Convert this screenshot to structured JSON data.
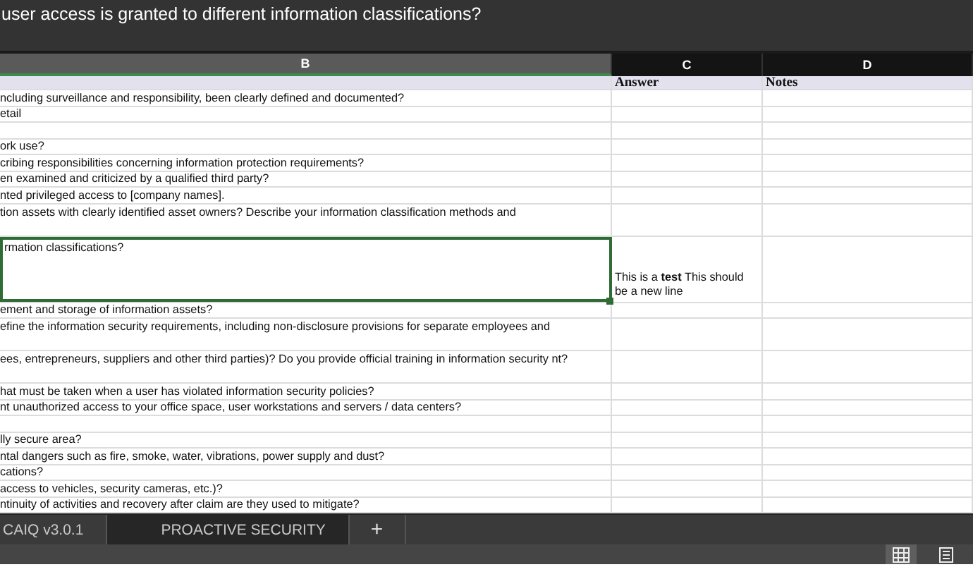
{
  "formula_bar": {
    "text": "user access is granted to different information classifications?"
  },
  "column_headers": [
    {
      "label": "B",
      "selected": true
    },
    {
      "label": "C",
      "selected": false
    },
    {
      "label": "D",
      "selected": false
    }
  ],
  "rows": [
    {
      "kind": "header",
      "selected": false,
      "cells": [
        "",
        "Answer",
        "Notes"
      ]
    },
    {
      "kind": "normal",
      "selected": false,
      "cells": [
        "ncluding surveillance and responsibility, been clearly defined and documented?",
        "",
        ""
      ]
    },
    {
      "kind": "normal",
      "selected": false,
      "cells": [
        "etail",
        "",
        ""
      ]
    },
    {
      "kind": "normal",
      "selected": false,
      "cells": [
        "",
        "",
        ""
      ]
    },
    {
      "kind": "normal",
      "selected": false,
      "cells": [
        "ork use?",
        "",
        ""
      ]
    },
    {
      "kind": "normal",
      "selected": false,
      "cells": [
        "cribing responsibilities concerning information protection requirements?",
        "",
        ""
      ]
    },
    {
      "kind": "normal",
      "selected": false,
      "cells": [
        "en examined and criticized by a qualified third party?",
        "",
        ""
      ]
    },
    {
      "kind": "normal",
      "selected": false,
      "cells": [
        "nted privileged access to [company names].",
        "",
        ""
      ]
    },
    {
      "kind": "double",
      "selected": false,
      "cells": [
        "tion assets with clearly identified asset owners? Describe your information classification methods and",
        "",
        ""
      ]
    },
    {
      "kind": "tall",
      "selected": true,
      "cells": [
        "rmation classifications?",
        "This is a **test** This   should be a new line",
        ""
      ]
    },
    {
      "kind": "normal",
      "selected": false,
      "cells": [
        "ement and storage of information assets?",
        "",
        ""
      ]
    },
    {
      "kind": "double",
      "selected": false,
      "cells": [
        "efine the information security requirements, including non-disclosure provisions for separate employees and",
        "",
        ""
      ]
    },
    {
      "kind": "double",
      "selected": false,
      "cells": [
        "ees, entrepreneurs, suppliers and other third parties)? Do you provide official training in information security nt?",
        "",
        ""
      ]
    },
    {
      "kind": "normal",
      "selected": false,
      "cells": [
        "hat must be taken when a user has violated information security policies?",
        "",
        ""
      ]
    },
    {
      "kind": "normal",
      "selected": false,
      "cells": [
        "nt unauthorized access to your office space, user workstations and servers / data centers?",
        "",
        ""
      ]
    },
    {
      "kind": "normal",
      "selected": false,
      "cells": [
        "",
        "",
        ""
      ]
    },
    {
      "kind": "normal",
      "selected": false,
      "cells": [
        "lly secure area?",
        "",
        ""
      ]
    },
    {
      "kind": "normal",
      "selected": false,
      "cells": [
        "ntal dangers such as fire, smoke, water, vibrations, power supply and dust?",
        "",
        ""
      ]
    },
    {
      "kind": "normal",
      "selected": false,
      "cells": [
        "cations?",
        "",
        ""
      ]
    },
    {
      "kind": "normal",
      "selected": false,
      "cells": [
        "access to vehicles, security cameras, etc.)?",
        "",
        ""
      ]
    },
    {
      "kind": "normal",
      "selected": false,
      "cells": [
        "ntinuity of activities and recovery after claim are they used to mitigate?",
        "",
        ""
      ]
    }
  ],
  "sheet_tabs": [
    {
      "label": "CAIQ v3.0.1",
      "selected": false
    },
    {
      "label": "PROACTIVE SECURITY",
      "selected": true
    }
  ],
  "add_sheet": {
    "label": "+"
  },
  "view_buttons": [
    {
      "kind": "grid",
      "selected": true
    },
    {
      "kind": "page",
      "selected": false
    }
  ]
}
